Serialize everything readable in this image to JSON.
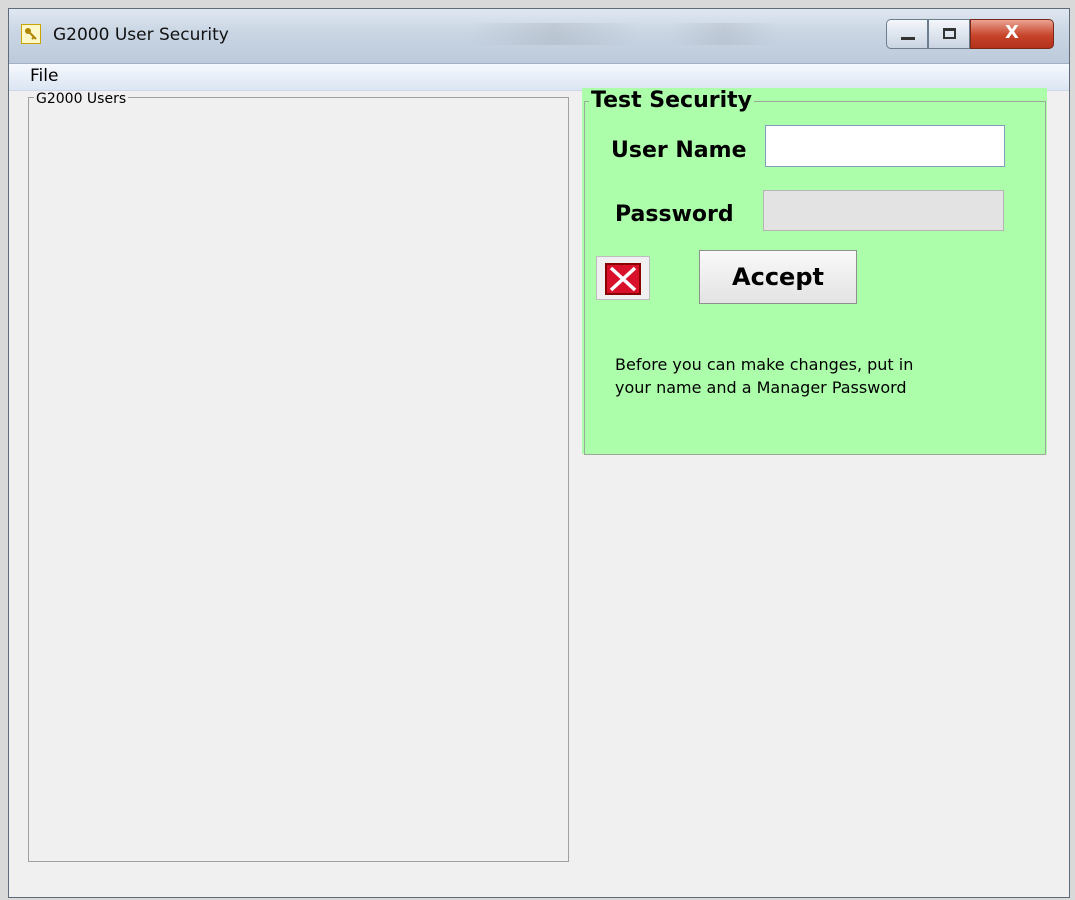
{
  "window": {
    "title": "G2000 User Security",
    "icon": "key-icon",
    "controls": {
      "minimize": "minimize-icon",
      "maximize": "maximize-icon",
      "close_glyph": "X"
    }
  },
  "menu": {
    "items": [
      {
        "label": "File"
      }
    ]
  },
  "users_panel": {
    "legend": "G2000 Users",
    "items": []
  },
  "security_panel": {
    "legend": "Test Security",
    "background_color": "#adfeab",
    "user_name_label": "User Name",
    "user_name_value": "",
    "password_label": "Password",
    "password_value": "",
    "cancel_icon": "red-x-icon",
    "accept_label": "Accept",
    "message_line1": "Before you can make changes, put in",
    "message_line2": "your name and a Manager Password"
  }
}
